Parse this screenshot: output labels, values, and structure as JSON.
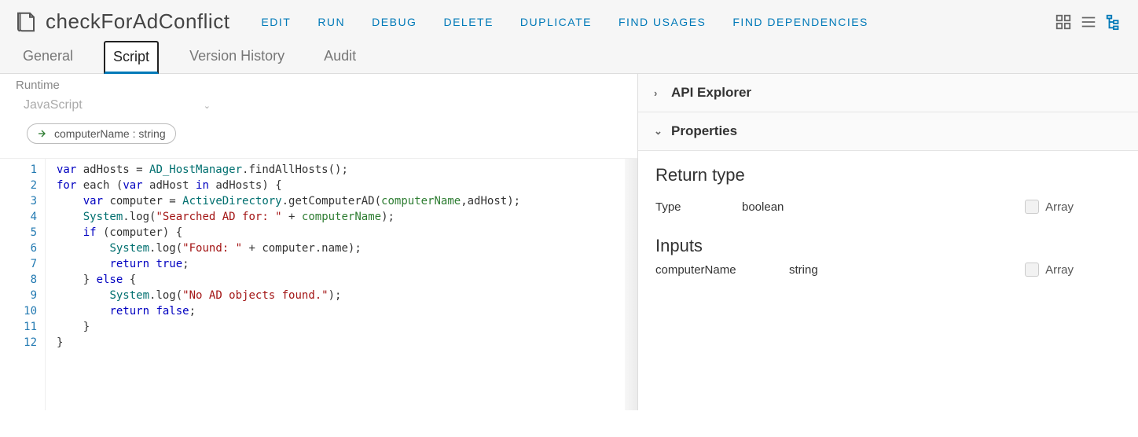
{
  "header": {
    "title": "checkForAdConflict",
    "actions": [
      "EDIT",
      "RUN",
      "DEBUG",
      "DELETE",
      "DUPLICATE",
      "FIND USAGES",
      "FIND DEPENDENCIES"
    ]
  },
  "tabs": [
    "General",
    "Script",
    "Version History",
    "Audit"
  ],
  "activeTab": "Script",
  "runtime": {
    "label": "Runtime",
    "value": "JavaScript"
  },
  "paramChip": "computerName : string",
  "code": {
    "lines": [
      {
        "n": 1,
        "tokens": [
          [
            "kw",
            "var"
          ],
          [
            "",
            " adHosts = "
          ],
          [
            "ident",
            "AD_HostManager"
          ],
          [
            "",
            ".findAllHosts();"
          ]
        ]
      },
      {
        "n": 2,
        "tokens": [
          [
            "kw",
            "for"
          ],
          [
            "",
            " each ("
          ],
          [
            "kw",
            "var"
          ],
          [
            "",
            " adHost "
          ],
          [
            "kw",
            "in"
          ],
          [
            "",
            " adHosts) {"
          ]
        ]
      },
      {
        "n": 3,
        "tokens": [
          [
            "",
            "    "
          ],
          [
            "kw",
            "var"
          ],
          [
            "",
            " computer = "
          ],
          [
            "ident",
            "ActiveDirectory"
          ],
          [
            "",
            ".getComputerAD("
          ],
          [
            "param",
            "computerName"
          ],
          [
            "",
            ",adHost);"
          ]
        ]
      },
      {
        "n": 4,
        "tokens": [
          [
            "",
            "    "
          ],
          [
            "ident",
            "System"
          ],
          [
            "",
            ".log("
          ],
          [
            "str",
            "\"Searched AD for: \""
          ],
          [
            "",
            " + "
          ],
          [
            "param",
            "computerName"
          ],
          [
            "",
            ");"
          ]
        ]
      },
      {
        "n": 5,
        "tokens": [
          [
            "",
            "    "
          ],
          [
            "kw",
            "if"
          ],
          [
            "",
            " (computer) {"
          ]
        ]
      },
      {
        "n": 6,
        "tokens": [
          [
            "",
            "        "
          ],
          [
            "ident",
            "System"
          ],
          [
            "",
            ".log("
          ],
          [
            "str",
            "\"Found: \""
          ],
          [
            "",
            " + computer.name);"
          ]
        ]
      },
      {
        "n": 7,
        "tokens": [
          [
            "",
            "        "
          ],
          [
            "kw",
            "return"
          ],
          [
            "",
            " "
          ],
          [
            "bool",
            "true"
          ],
          [
            "",
            ";"
          ]
        ]
      },
      {
        "n": 8,
        "tokens": [
          [
            "",
            "    } "
          ],
          [
            "kw",
            "else"
          ],
          [
            "",
            " {"
          ]
        ]
      },
      {
        "n": 9,
        "tokens": [
          [
            "",
            "        "
          ],
          [
            "ident",
            "System"
          ],
          [
            "",
            ".log("
          ],
          [
            "str",
            "\"No AD objects found.\""
          ],
          [
            "",
            ");"
          ]
        ]
      },
      {
        "n": 10,
        "tokens": [
          [
            "",
            "        "
          ],
          [
            "kw",
            "return"
          ],
          [
            "",
            " "
          ],
          [
            "bool",
            "false"
          ],
          [
            "",
            ";"
          ]
        ]
      },
      {
        "n": 11,
        "tokens": [
          [
            "",
            "    }"
          ]
        ]
      },
      {
        "n": 12,
        "tokens": [
          [
            "",
            "}"
          ]
        ]
      }
    ]
  },
  "rightPane": {
    "apiExplorer": "API Explorer",
    "properties": "Properties",
    "returnTypeHeader": "Return type",
    "typeLabel": "Type",
    "typeValue": "boolean",
    "arrayLabel": "Array",
    "inputsHeader": "Inputs",
    "inputs": [
      {
        "name": "computerName",
        "type": "string"
      }
    ]
  }
}
